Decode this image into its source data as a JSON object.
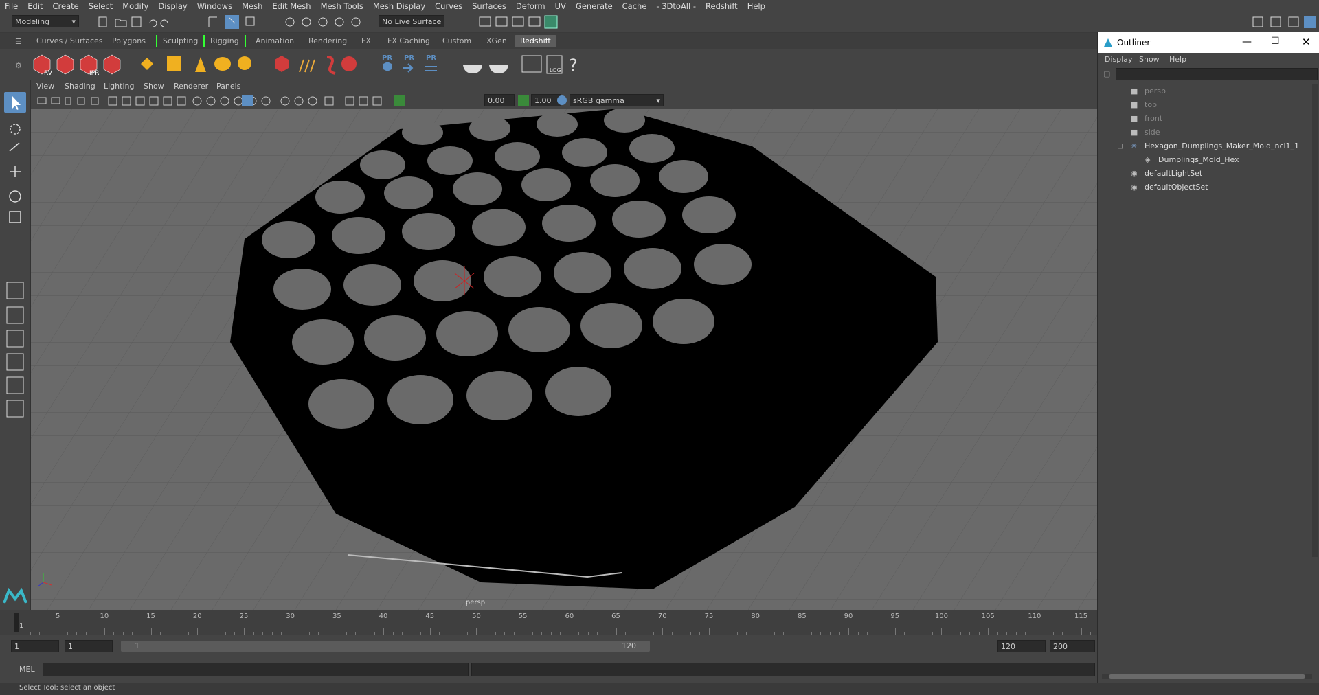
{
  "menubar": [
    "File",
    "Edit",
    "Create",
    "Select",
    "Modify",
    "Display",
    "Windows",
    "Mesh",
    "Edit Mesh",
    "Mesh Tools",
    "Mesh Display",
    "Curves",
    "Surfaces",
    "Deform",
    "UV",
    "Generate",
    "Cache",
    "- 3DtoAll -",
    "Redshift",
    "Help"
  ],
  "status": {
    "workspace": "Modeling",
    "live_surface": "No Live Surface"
  },
  "shelf_tabs": [
    "Curves / Surfaces",
    "Polygons",
    "Sculpting",
    "Rigging",
    "Animation",
    "Rendering",
    "FX",
    "FX Caching",
    "Custom",
    "XGen",
    "Redshift"
  ],
  "shelf_active": "Redshift",
  "shelf_labels": {
    "rv": "RV",
    "ipr": "IPR",
    "pr1": "PR",
    "pr2": "PR",
    "pr3": "PR",
    "log": "LOG"
  },
  "viewport_menu": [
    "View",
    "Shading",
    "Lighting",
    "Show",
    "Renderer",
    "Panels"
  ],
  "viewport_toolbar": {
    "exposure": "0.00",
    "gamma": "1.00",
    "color_space": "sRGB gamma"
  },
  "viewport_label": "persp",
  "timeline": {
    "ticks": [
      "5",
      "10",
      "15",
      "20",
      "25",
      "30",
      "35",
      "40",
      "45",
      "50",
      "55",
      "60",
      "65",
      "70",
      "75",
      "80",
      "85",
      "90",
      "95",
      "100",
      "105",
      "110",
      "115"
    ],
    "current": "1"
  },
  "range": {
    "start": "1",
    "current": "1",
    "slider_start": "1",
    "slider_end": "120",
    "end": "120",
    "max": "200"
  },
  "cmd_label": "MEL",
  "help_line": "Select Tool: select an object",
  "outliner": {
    "title": "Outliner",
    "menu": [
      "Display",
      "Show",
      "Help"
    ],
    "items": [
      {
        "label": "persp",
        "kind": "camera"
      },
      {
        "label": "top",
        "kind": "camera"
      },
      {
        "label": "front",
        "kind": "camera"
      },
      {
        "label": "side",
        "kind": "camera"
      },
      {
        "label": "Hexagon_Dumplings_Maker_Mold_ncl1_1",
        "kind": "group"
      },
      {
        "label": "Dumplings_Mold_Hex",
        "kind": "mesh"
      },
      {
        "label": "defaultLightSet",
        "kind": "set"
      },
      {
        "label": "defaultObjectSet",
        "kind": "set"
      }
    ]
  },
  "colors": {
    "accent": "#5d8fc3",
    "shelf_red": "#d23c3c",
    "ui_bg": "#444444",
    "viewport_bg": "#6a6a6a",
    "grid": "#5a5a5a",
    "mesh": "#000000"
  }
}
